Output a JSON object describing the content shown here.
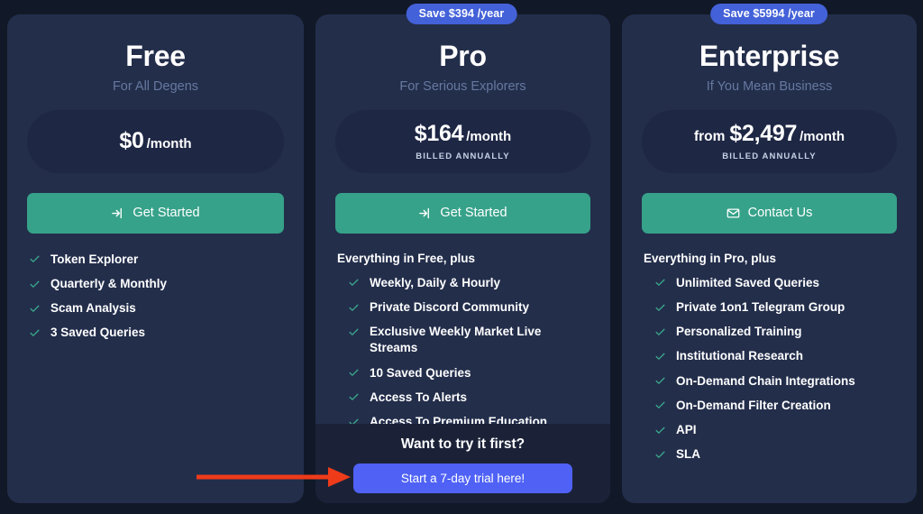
{
  "theme": {
    "page_bg": "#111827",
    "card_bg": "#232e4b",
    "pill_bg": "#1e2744",
    "footer_bg": "#1b2238",
    "accent_green": "#36a289",
    "accent_blue": "#4361d8",
    "trial_blue": "#4f62f5",
    "check_green": "#3aa98c",
    "subtitle": "#66799f",
    "arrow_red": "#ee3b1a"
  },
  "plans": [
    {
      "id": "free",
      "name": "Free",
      "tagline": "For All Degens",
      "badge": null,
      "price_prefix": "",
      "price_amount": "$0",
      "price_period": "/month",
      "price_note": "",
      "cta_label": "Get Started",
      "cta_icon": "login-arrow-icon",
      "features_heading": "",
      "features": [
        "Token Explorer",
        "Quarterly & Monthly",
        "Scam Analysis",
        "3 Saved Queries"
      ],
      "trial": null
    },
    {
      "id": "pro",
      "name": "Pro",
      "tagline": "For Serious Explorers",
      "badge": "Save $394 /year",
      "price_prefix": "",
      "price_amount": "$164",
      "price_period": "/month",
      "price_note": "BILLED ANNUALLY",
      "cta_label": "Get Started",
      "cta_icon": "login-arrow-icon",
      "features_heading": "Everything in Free, plus",
      "features": [
        "Weekly, Daily & Hourly",
        "Private Discord Community",
        "Exclusive Weekly Market Live Streams",
        "10 Saved Queries",
        "Access To Alerts",
        "Access To Premium Education"
      ],
      "trial": {
        "title": "Want to try it first?",
        "button_label": "Start a 7-day trial here!"
      }
    },
    {
      "id": "enterprise",
      "name": "Enterprise",
      "tagline": "If You Mean Business",
      "badge": "Save $5994 /year",
      "price_prefix": "from",
      "price_amount": "$2,497",
      "price_period": "/month",
      "price_note": "BILLED ANNUALLY",
      "cta_label": "Contact Us",
      "cta_icon": "envelope-icon",
      "features_heading": "Everything in Pro, plus",
      "features": [
        "Unlimited Saved Queries",
        "Private 1on1 Telegram Group",
        "Personalized Training",
        "Institutional Research",
        "On-Demand Chain Integrations",
        "On-Demand Filter Creation",
        "API",
        "SLA"
      ],
      "trial": null
    }
  ],
  "annotation": {
    "type": "arrow",
    "points_to": "Start a 7-day trial here!",
    "color": "#ee3b1a"
  }
}
